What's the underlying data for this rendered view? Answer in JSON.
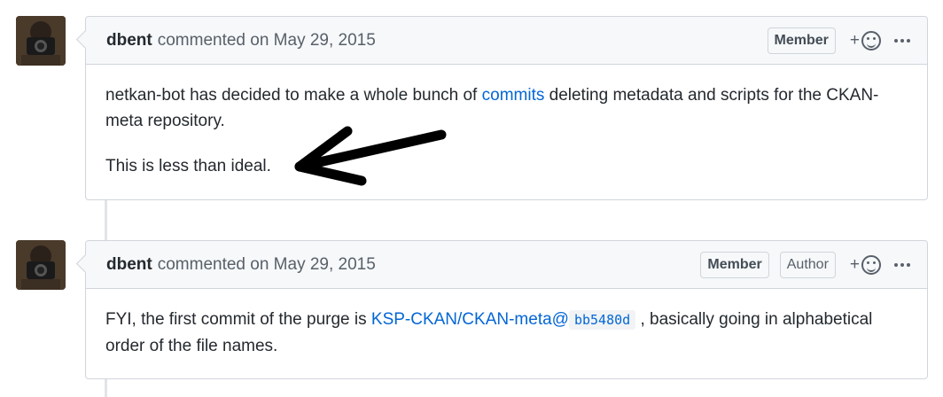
{
  "comments": [
    {
      "author": "dbent",
      "meta": "commented on May 29, 2015",
      "labels": [
        "Member"
      ],
      "reaction_plus": "+",
      "body": {
        "p1_before": "netkan-bot has decided to make a whole bunch of ",
        "p1_link": "commits",
        "p1_after": " deleting metadata and scripts for the CKAN-meta repository.",
        "p2": "This is less than ideal."
      }
    },
    {
      "author": "dbent",
      "meta": "commented on May 29, 2015",
      "labels": [
        "Member",
        "Author"
      ],
      "reaction_plus": "+",
      "body": {
        "p1_before": "FYI, the first commit of the purge is ",
        "p1_link": "KSP-CKAN/CKAN-meta@",
        "p1_code": "bb5480d",
        "p1_after": " , basically going in alphabetical order of the file names."
      }
    }
  ],
  "icons": {
    "avatar": "avatar-photo",
    "reaction": "smiley-icon",
    "more": "kebab-icon",
    "annotation": "arrow-annotation"
  }
}
